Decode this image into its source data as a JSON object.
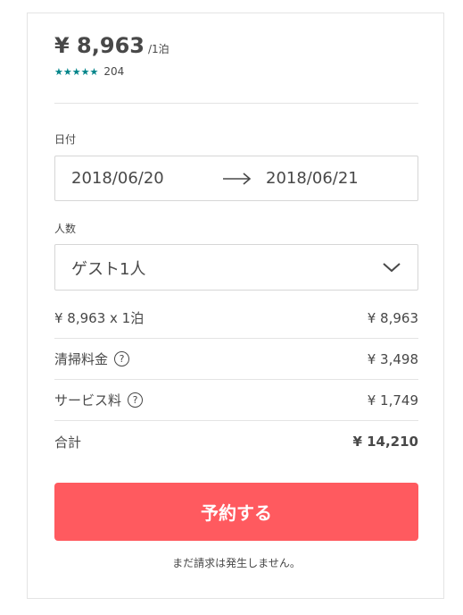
{
  "listing": {
    "price": "¥ 8,963",
    "per_night": "/1泊",
    "stars": "★★★★★",
    "review_count": "204"
  },
  "dates": {
    "label": "日付",
    "checkin": "2018/06/20",
    "checkout": "2018/06/21"
  },
  "guests": {
    "label": "人数",
    "selected": "ゲスト1人"
  },
  "breakdown": [
    {
      "label": "¥ 8,963 x 1泊",
      "value": "¥ 8,963"
    },
    {
      "label": "清掃料金",
      "value": "¥ 3,498"
    },
    {
      "label": "サービス料",
      "value": "¥ 1,749"
    },
    {
      "label": "合計",
      "value": "¥ 14,210"
    }
  ],
  "help_glyph": "?",
  "reserve_label": "予約する",
  "note": "まだ請求は発生しません。",
  "colors": {
    "accent": "#ff5a5f",
    "stars": "#008489",
    "text": "#484848",
    "border": "#e4e4e4"
  },
  "icons": [
    "star-icon",
    "arrow-right-icon",
    "chevron-down-icon",
    "help-icon"
  ]
}
